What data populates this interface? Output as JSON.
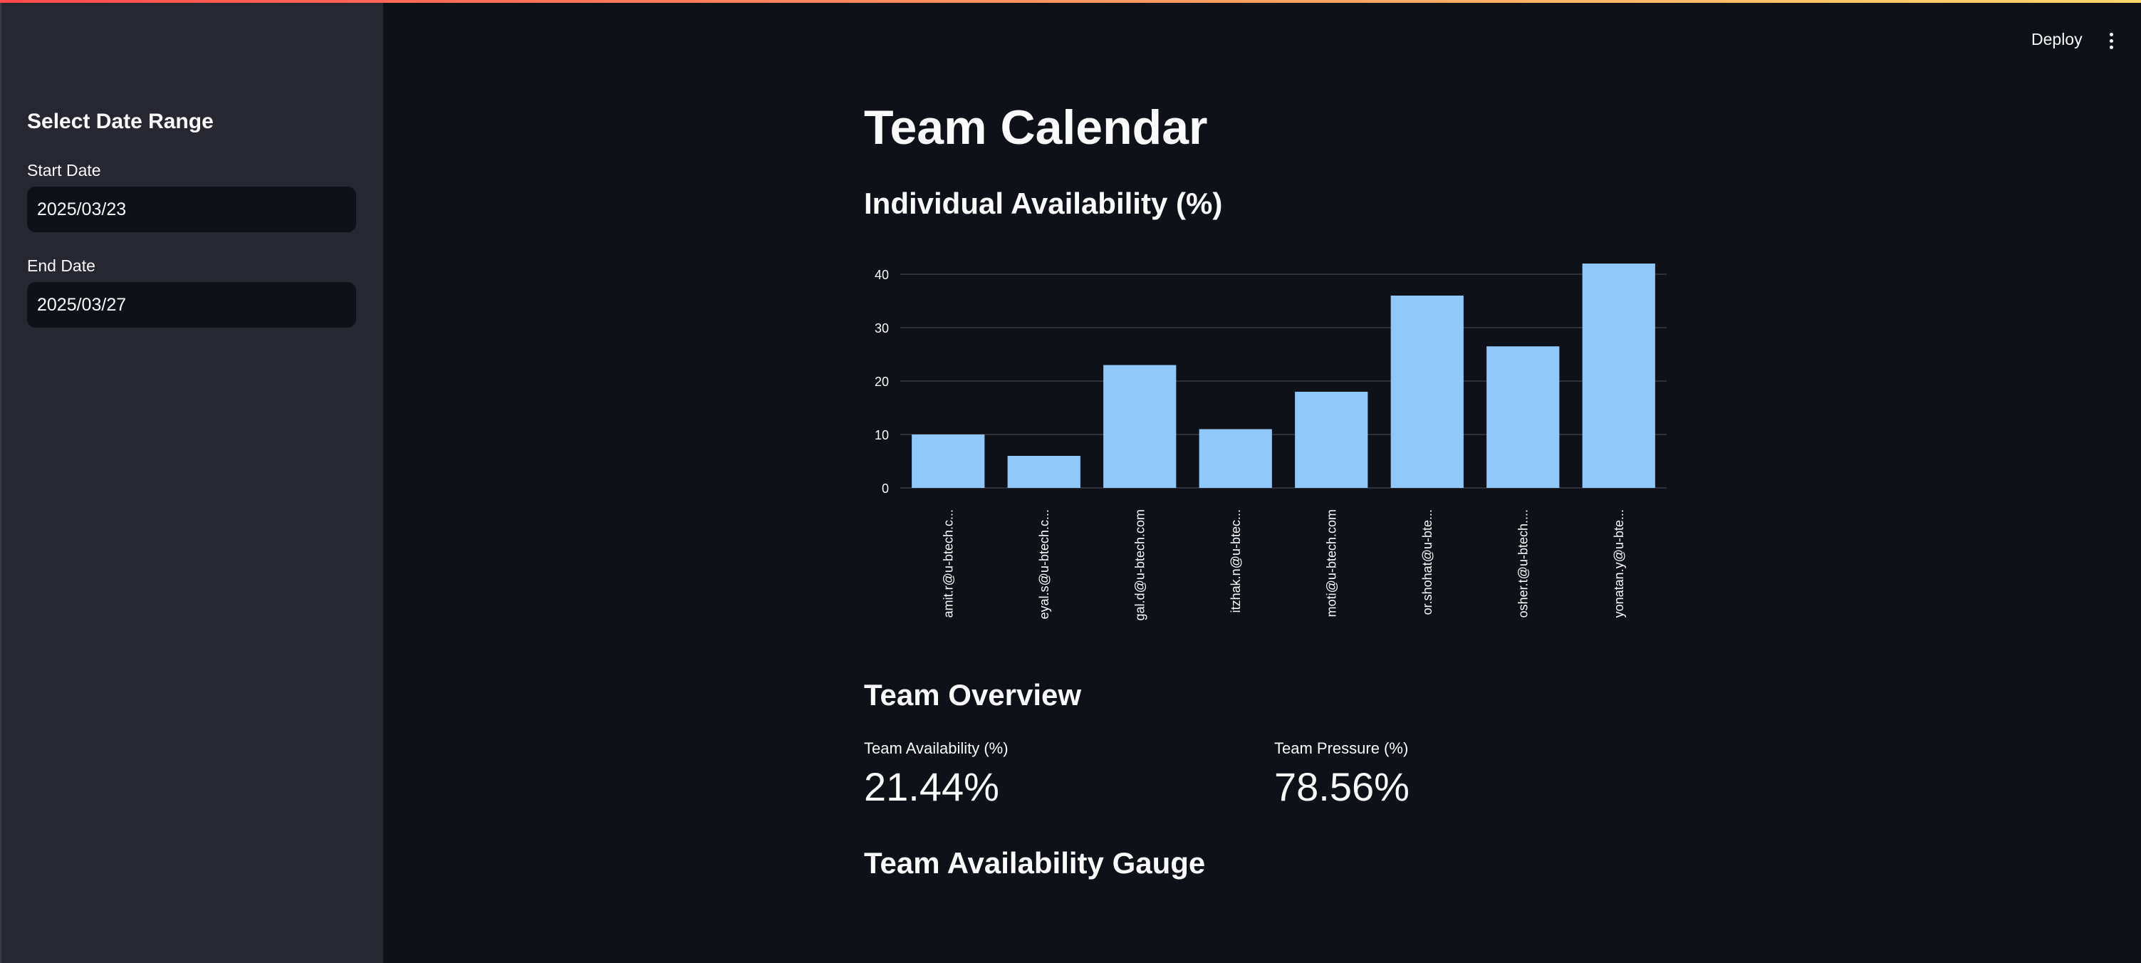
{
  "sidebar": {
    "title": "Select Date Range",
    "start_label": "Start Date",
    "start_value": "2025/03/23",
    "end_label": "End Date",
    "end_value": "2025/03/27"
  },
  "toolbar": {
    "deploy_label": "Deploy",
    "menu_icon": "kebab-menu-icon"
  },
  "main": {
    "title": "Team Calendar",
    "chart_heading": "Individual Availability (%)",
    "overview_heading": "Team Overview",
    "metrics": [
      {
        "label": "Team Availability (%)",
        "value": "21.44%"
      },
      {
        "label": "Team Pressure (%)",
        "value": "78.56%"
      }
    ],
    "gauge_heading": "Team Availability Gauge"
  },
  "colors": {
    "accent": "#ff4b4b",
    "bar": "#90c9f9",
    "background": "#0e1117",
    "sidebar": "#262730"
  },
  "chart_data": {
    "type": "bar",
    "categories": [
      "amit.r@u-btech.c...",
      "eyal.s@u-btech.c...",
      "gal.d@u-btech.com",
      "itzhak.n@u-btec...",
      "moti@u-btech.com",
      "or.shohat@u-bte...",
      "osher.t@u-btech....",
      "yonatan.y@u-bte..."
    ],
    "values": [
      10,
      6,
      23,
      11,
      18,
      36,
      26.5,
      42
    ],
    "yticks": [
      0,
      10,
      20,
      30,
      40
    ],
    "ylim": [
      0,
      42
    ],
    "grid": true
  }
}
